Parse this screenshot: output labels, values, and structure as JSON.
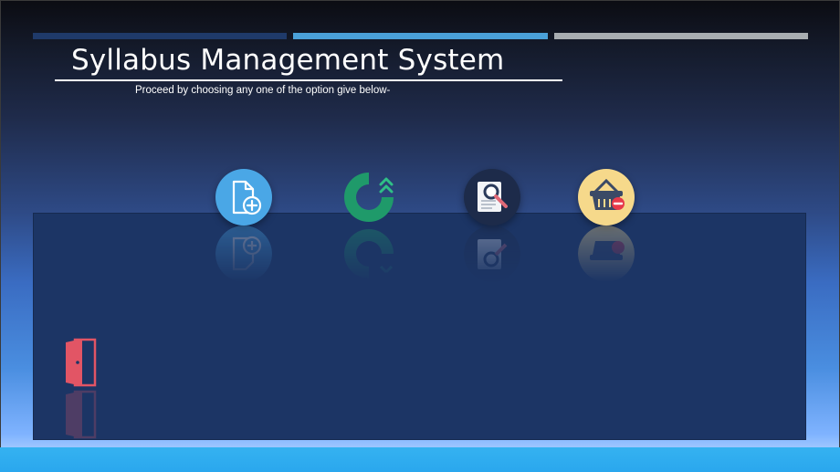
{
  "header": {
    "title": "Syllabus Management System",
    "subtitle": "Proceed by choosing any one of the option give below-"
  },
  "options": [
    {
      "id": "add",
      "icon": "add-document-icon"
    },
    {
      "id": "update",
      "icon": "update-progress-icon"
    },
    {
      "id": "search",
      "icon": "search-document-icon"
    },
    {
      "id": "delete",
      "icon": "remove-basket-icon"
    }
  ],
  "exit": {
    "icon": "exit-door-icon"
  },
  "colors": {
    "stripe_1": "#1f3a6a",
    "stripe_2": "#4aa0d8",
    "stripe_3": "#a8adb1",
    "panel": "#1c3565",
    "bottom_bar": "#35b2f0",
    "add_icon_bg": "#4aa7e6",
    "update_icon_green": "#1f9a6a",
    "search_icon_bg": "#1d2b4a",
    "delete_icon_bg": "#f6d98b",
    "door_red": "#e25565"
  }
}
